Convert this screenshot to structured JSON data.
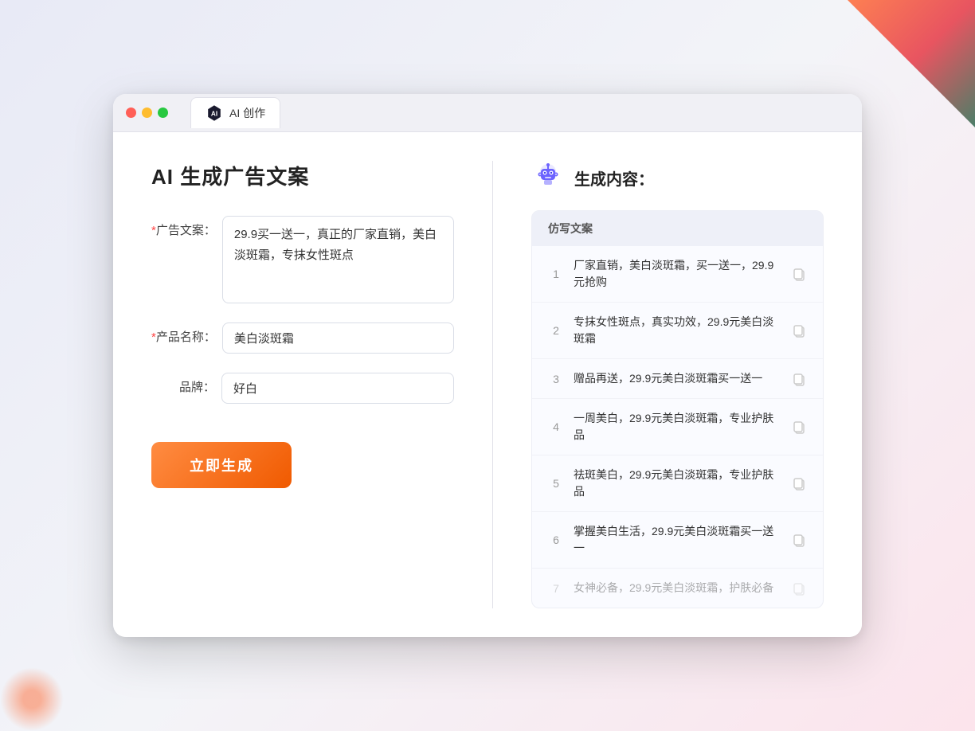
{
  "browser": {
    "tab_label": "AI 创作"
  },
  "page": {
    "title": "AI 生成广告文案",
    "result_title": "生成内容："
  },
  "form": {
    "ad_text_label": "广告文案：",
    "ad_text_required": "*",
    "ad_text_value": "29.9买一送一，真正的厂家直销，美白淡斑霜，专抹女性斑点",
    "product_name_label": "产品名称：",
    "product_name_required": "*",
    "product_name_value": "美白淡斑霜",
    "brand_label": "品牌：",
    "brand_value": "好白",
    "generate_button": "立即生成"
  },
  "results": {
    "table_header": "仿写文案",
    "rows": [
      {
        "number": "1",
        "text": "厂家直销，美白淡斑霜，买一送一，29.9元抢购",
        "faded": false
      },
      {
        "number": "2",
        "text": "专抹女性斑点，真实功效，29.9元美白淡斑霜",
        "faded": false
      },
      {
        "number": "3",
        "text": "赠品再送，29.9元美白淡斑霜买一送一",
        "faded": false
      },
      {
        "number": "4",
        "text": "一周美白，29.9元美白淡斑霜，专业护肤品",
        "faded": false
      },
      {
        "number": "5",
        "text": "祛斑美白，29.9元美白淡斑霜，专业护肤品",
        "faded": false
      },
      {
        "number": "6",
        "text": "掌握美白生活，29.9元美白淡斑霜买一送一",
        "faded": false
      },
      {
        "number": "7",
        "text": "女神必备，29.9元美白淡斑霜，护肤必备",
        "faded": true
      }
    ]
  }
}
